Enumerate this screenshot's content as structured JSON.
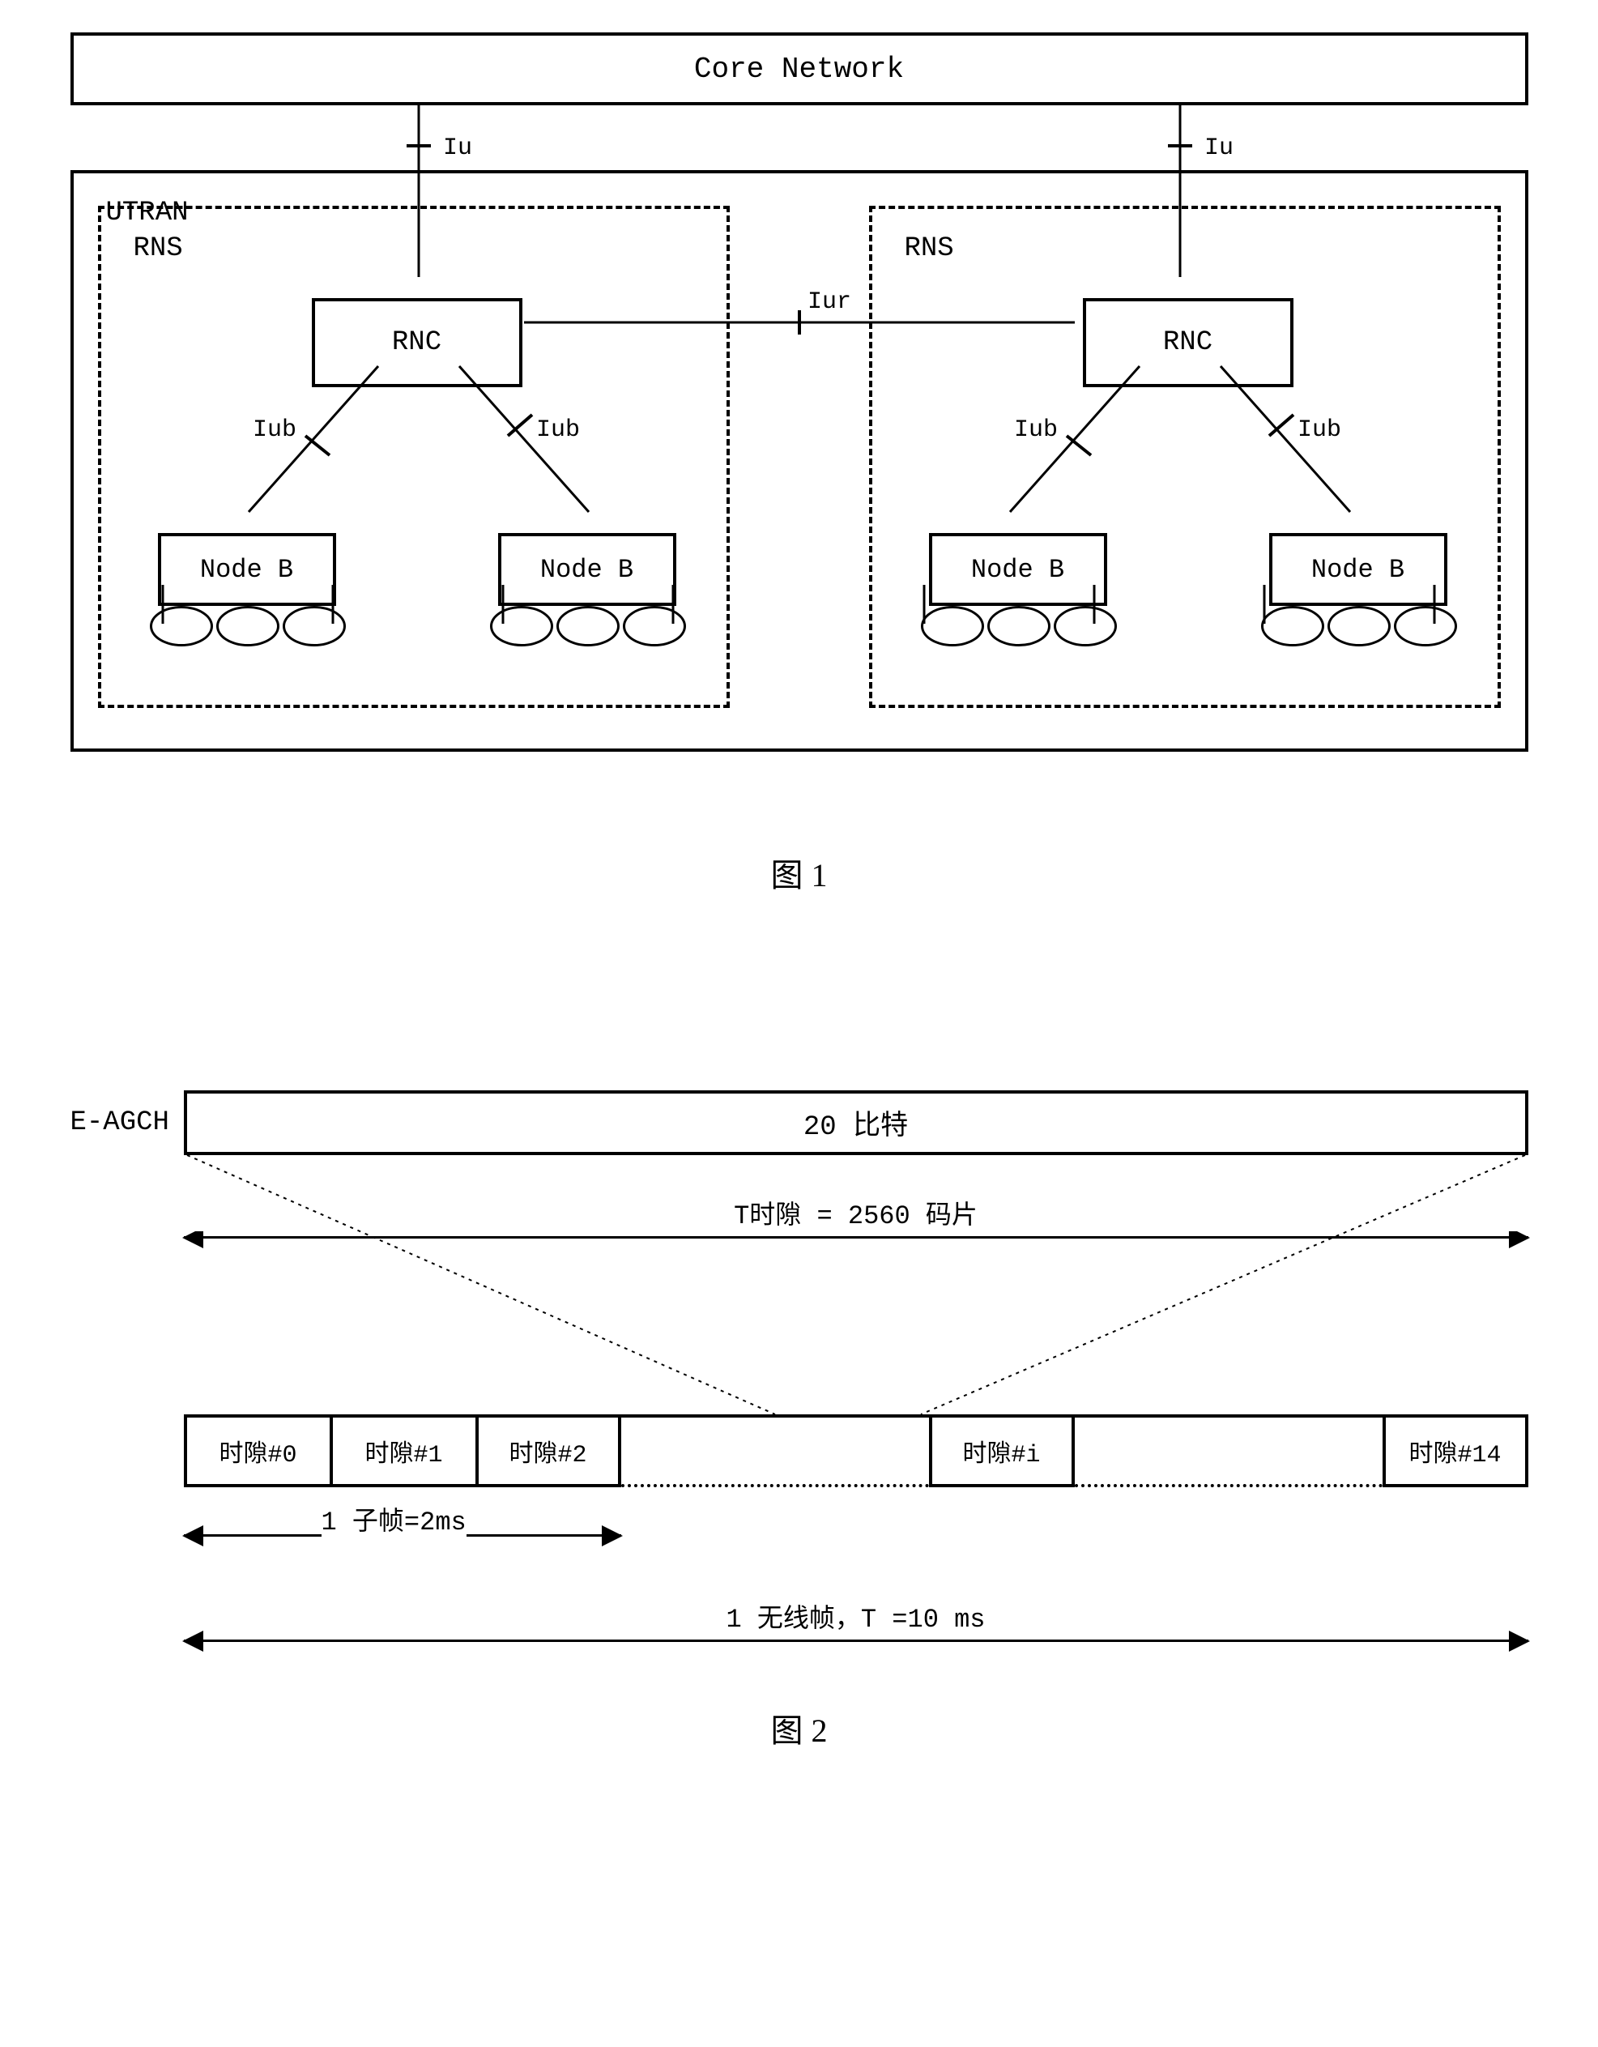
{
  "fig1": {
    "core_network": "Core Network",
    "utran_label": "UTRAN",
    "rns_label": "RNS",
    "rnc_label": "RNC",
    "nodeb_label": "Node B",
    "interfaces": {
      "iu": "Iu",
      "iur": "Iur",
      "iub": "Iub"
    },
    "caption": "图 1"
  },
  "fig2": {
    "eagch_label": "E-AGCH",
    "bits_label": "20 比特",
    "tslot_label": "T时隙 = 2560 码片",
    "slots": {
      "s0": "时隙#0",
      "s1": "时隙#1",
      "s2": "时隙#2",
      "si": "时隙#i",
      "s14": "时隙#14"
    },
    "subframe_label": "1 子帧=2ms",
    "radioframe_label": "1 无线帧，T =10 ms",
    "caption": "图 2"
  },
  "chart_data": [
    {
      "type": "diagram",
      "title": "图 1 — UTRAN architecture",
      "nodes": [
        {
          "id": "core",
          "label": "Core Network"
        },
        {
          "id": "utran",
          "label": "UTRAN",
          "contains": [
            "rns1",
            "rns2"
          ]
        },
        {
          "id": "rns1",
          "label": "RNS",
          "contains": [
            "rnc1",
            "nodeb1a",
            "nodeb1b"
          ]
        },
        {
          "id": "rns2",
          "label": "RNS",
          "contains": [
            "rnc2",
            "nodeb2a",
            "nodeb2b"
          ]
        },
        {
          "id": "rnc1",
          "label": "RNC"
        },
        {
          "id": "rnc2",
          "label": "RNC"
        },
        {
          "id": "nodeb1a",
          "label": "Node B",
          "cells": 3
        },
        {
          "id": "nodeb1b",
          "label": "Node B",
          "cells": 3
        },
        {
          "id": "nodeb2a",
          "label": "Node B",
          "cells": 3
        },
        {
          "id": "nodeb2b",
          "label": "Node B",
          "cells": 3
        }
      ],
      "edges": [
        {
          "from": "core",
          "to": "rnc1",
          "label": "Iu"
        },
        {
          "from": "core",
          "to": "rnc2",
          "label": "Iu"
        },
        {
          "from": "rnc1",
          "to": "rnc2",
          "label": "Iur"
        },
        {
          "from": "rnc1",
          "to": "nodeb1a",
          "label": "Iub"
        },
        {
          "from": "rnc1",
          "to": "nodeb1b",
          "label": "Iub"
        },
        {
          "from": "rnc2",
          "to": "nodeb2a",
          "label": "Iub"
        },
        {
          "from": "rnc2",
          "to": "nodeb2b",
          "label": "Iub"
        }
      ]
    },
    {
      "type": "diagram",
      "title": "图 2 — E-AGCH frame structure",
      "channel": "E-AGCH",
      "bits_per_slot": 20,
      "slot_duration_chips": 2560,
      "slots_per_radioframe": 15,
      "slot_labels": [
        "时隙#0",
        "时隙#1",
        "时隙#2",
        "…",
        "时隙#i",
        "…",
        "时隙#14"
      ],
      "subframe": {
        "slots": 3,
        "duration_ms": 2
      },
      "radioframe": {
        "slots": 15,
        "duration_ms": 10
      }
    }
  ]
}
